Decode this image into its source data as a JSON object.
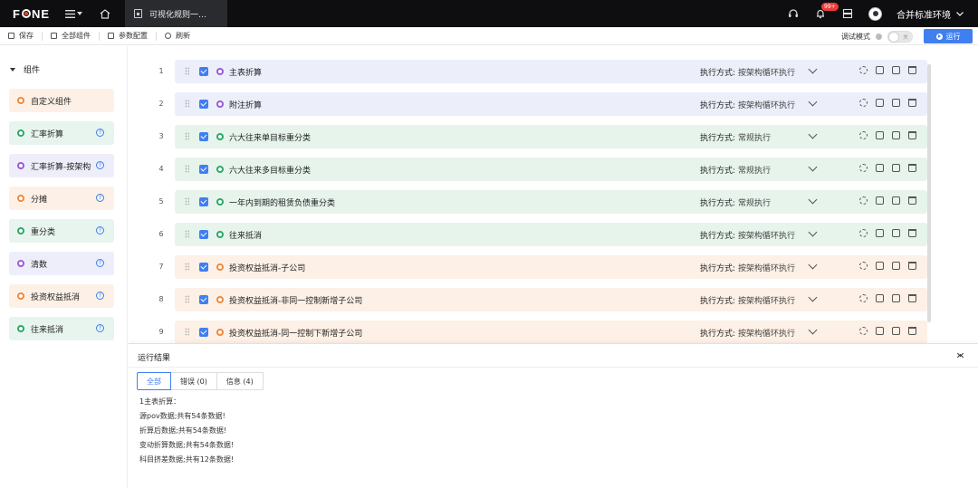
{
  "header": {
    "logo": "F●NE",
    "tab_title": "可视化规则一…",
    "notification_badge": "99+",
    "env_label": "合并标准环境"
  },
  "toolbar": {
    "save_label": "保存",
    "all_components_label": "全部组件",
    "param_config_label": "参数配置",
    "refresh_label": "刷新",
    "debug_label": "调试模式",
    "toggle_label": "关",
    "run_label": "运行"
  },
  "sidebar": {
    "heading": "组件",
    "items": [
      {
        "label": "自定义组件",
        "color": "#ef8a3c",
        "help": false
      },
      {
        "label": "汇率折算",
        "color": "#2fa866",
        "help": true
      },
      {
        "label": "汇率折算-按架构",
        "color": "#9a5cd6",
        "help": true
      },
      {
        "label": "分摊",
        "color": "#ef8a3c",
        "help": true
      },
      {
        "label": "重分类",
        "color": "#2fa866",
        "help": true
      },
      {
        "label": "清数",
        "color": "#9a5cd6",
        "help": true
      },
      {
        "label": "投资权益抵消",
        "color": "#ef8a3c",
        "help": true
      },
      {
        "label": "往来抵消",
        "color": "#2fa866",
        "help": true
      }
    ],
    "help_glyph": "?"
  },
  "rows": {
    "mode_label": "执行方式:",
    "items": [
      {
        "num": "1",
        "name": "主表折算",
        "mode": "按架构循环执行",
        "tone": "purple"
      },
      {
        "num": "2",
        "name": "附注折算",
        "mode": "按架构循环执行",
        "tone": "purple"
      },
      {
        "num": "3",
        "name": "六大往来单目标重分类",
        "mode": "常规执行",
        "tone": "green"
      },
      {
        "num": "4",
        "name": "六大往来多目标重分类",
        "mode": "常规执行",
        "tone": "green"
      },
      {
        "num": "5",
        "name": "一年内到期的租赁负债重分类",
        "mode": "常规执行",
        "tone": "green"
      },
      {
        "num": "6",
        "name": "往来抵消",
        "mode": "按架构循环执行",
        "tone": "green"
      },
      {
        "num": "7",
        "name": "投资权益抵消-子公司",
        "mode": "按架构循环执行",
        "tone": "orange"
      },
      {
        "num": "8",
        "name": "投资权益抵消-非同一控制新增子公司",
        "mode": "按架构循环执行",
        "tone": "orange"
      },
      {
        "num": "9",
        "name": "投资权益抵消-同一控制下新增子公司",
        "mode": "按架构循环执行",
        "tone": "orange"
      }
    ]
  },
  "results": {
    "title": "运行结果",
    "tabs": [
      "全部",
      "错误 (0)",
      "信息 (4)"
    ],
    "lines": [
      "1主表折算：",
      "源pov数据;共有54条数据!",
      "折算后数据;共有54条数据!",
      "变动折算数据;共有54条数据!",
      "科目挤差数据;共有12条数据!"
    ]
  },
  "colors": {
    "accent": "#3f7ff0",
    "purple": "#9a5cd6",
    "green": "#2fa866",
    "orange": "#ef8a3c"
  }
}
